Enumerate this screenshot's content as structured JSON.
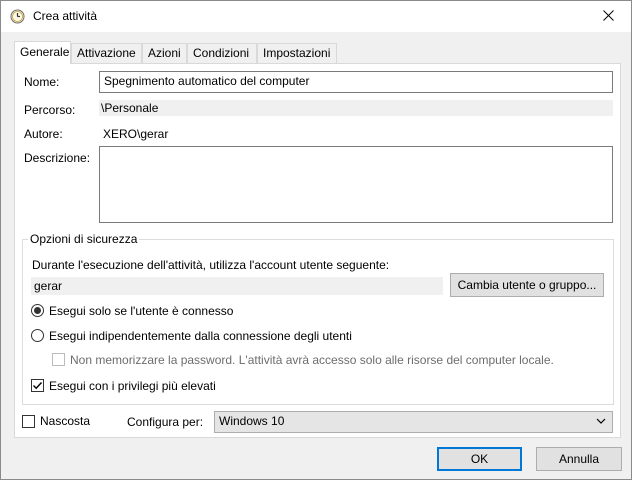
{
  "window": {
    "title": "Crea attività",
    "icon": "clock-icon"
  },
  "tabs": [
    {
      "label": "Generale",
      "active": true
    },
    {
      "label": "Attivazione",
      "active": false
    },
    {
      "label": "Azioni",
      "active": false
    },
    {
      "label": "Condizioni",
      "active": false
    },
    {
      "label": "Impostazioni",
      "active": false
    }
  ],
  "general": {
    "name_label": "Nome:",
    "name_value": "Spegnimento automatico del computer",
    "path_label": "Percorso:",
    "path_value": "\\Personale",
    "author_label": "Autore:",
    "author_value": "XERO\\gerar",
    "description_label": "Descrizione:",
    "description_value": ""
  },
  "security": {
    "title": "Opzioni di sicurezza",
    "account_prompt": "Durante l'esecuzione dell'attività, utilizza l'account utente seguente:",
    "account_value": "gerar",
    "change_user_button": "Cambia utente o gruppo...",
    "radio_logged_on": {
      "label": "Esegui solo se l'utente è connesso",
      "checked": true
    },
    "radio_independent": {
      "label": "Esegui indipendentemente dalla connessione degli utenti",
      "checked": false
    },
    "no_store_password": {
      "label": "Non memorizzare la password. L'attività avrà accesso solo alle risorse del computer locale.",
      "checked": false,
      "disabled": true
    },
    "highest_privileges": {
      "label": "Esegui con i privilegi più elevati",
      "checked": true
    }
  },
  "bottom": {
    "hidden_label": "Nascosta",
    "hidden_checked": false,
    "configure_label": "Configura per:",
    "configure_value": "Windows 10"
  },
  "buttons": {
    "ok": "OK",
    "cancel": "Annulla"
  }
}
